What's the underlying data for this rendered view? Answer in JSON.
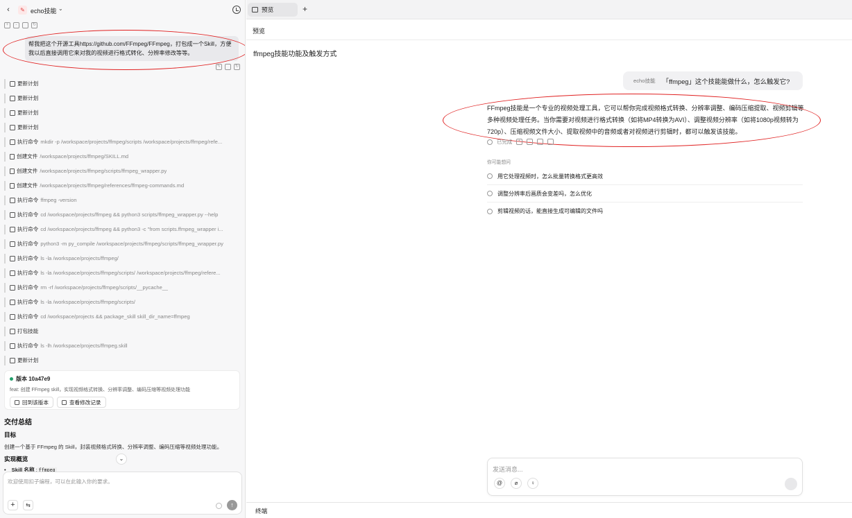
{
  "header": {
    "back_icon": "chevron-left-icon",
    "app_name": "echo技能",
    "history_icon": "history-icon"
  },
  "chat": {
    "user_message": "帮我把这个开源工具https://github.com/FFmpeg/FFmpeg，打包成一个Skill，方便我以后直接调用它来对我的视频进行格式转化、分辨率修改等等。",
    "steps": [
      {
        "icon": "terminal-icon",
        "label": "更新计划",
        "arg": ""
      },
      {
        "icon": "terminal-icon",
        "label": "更新计划",
        "arg": ""
      },
      {
        "icon": "terminal-icon",
        "label": "更新计划",
        "arg": ""
      },
      {
        "icon": "terminal-icon",
        "label": "更新计划",
        "arg": ""
      },
      {
        "icon": "terminal-icon",
        "label": "执行命令",
        "arg": "mkdir -p /workspace/projects/ffmpeg/scripts /workspace/projects/ffmpeg/refe..."
      },
      {
        "icon": "file-icon",
        "label": "创建文件",
        "arg": "/workspace/projects/ffmpeg/SKILL.md"
      },
      {
        "icon": "file-icon",
        "label": "创建文件",
        "arg": "/workspace/projects/ffmpeg/scripts/ffmpeg_wrapper.py"
      },
      {
        "icon": "file-icon",
        "label": "创建文件",
        "arg": "/workspace/projects/ffmpeg/references/ffmpeg-commands.md"
      },
      {
        "icon": "terminal-icon",
        "label": "执行命令",
        "arg": "ffmpeg -version"
      },
      {
        "icon": "terminal-icon",
        "label": "执行命令",
        "arg": "cd /workspace/projects/ffmpeg && python3 scripts/ffmpeg_wrapper.py --help"
      },
      {
        "icon": "terminal-icon",
        "label": "执行命令",
        "arg": "cd /workspace/projects/ffmpeg && python3 -c \"from scripts.ffmpeg_wrapper i..."
      },
      {
        "icon": "terminal-icon",
        "label": "执行命令",
        "arg": "python3 -m py_compile /workspace/projects/ffmpeg/scripts/ffmpeg_wrapper.py"
      },
      {
        "icon": "terminal-icon",
        "label": "执行命令",
        "arg": "ls -la /workspace/projects/ffmpeg/"
      },
      {
        "icon": "terminal-icon",
        "label": "执行命令",
        "arg": "ls -la /workspace/projects/ffmpeg/scripts/ /workspace/projects/ffmpeg/refere..."
      },
      {
        "icon": "terminal-icon",
        "label": "执行命令",
        "arg": "rm -rf /workspace/projects/ffmpeg/scripts/__pycache__"
      },
      {
        "icon": "terminal-icon",
        "label": "执行命令",
        "arg": "ls -la /workspace/projects/ffmpeg/scripts/"
      },
      {
        "icon": "terminal-icon",
        "label": "执行命令",
        "arg": "cd /workspace/projects && package_skill skill_dir_name=ffmpeg"
      },
      {
        "icon": "terminal-icon",
        "label": "打包技能",
        "arg": ""
      },
      {
        "icon": "terminal-icon",
        "label": "执行命令",
        "arg": "ls -lh /workspace/projects/ffmpeg.skill"
      },
      {
        "icon": "terminal-icon",
        "label": "更新计划",
        "arg": ""
      }
    ],
    "version": {
      "title": "版本 10a47e9",
      "desc": "feat: 创建 FFmpeg skill，实现视频格式转换、分辨率调整、编码压缩等视频处理功能",
      "rollback_label": "回到该版本",
      "history_label": "查看修改记录"
    },
    "summary": {
      "heading": "交付总结",
      "goal_heading": "目标",
      "goal_text": "创建一个基于 FFmpeg 的 Skill，封装视频格式转换、分辨率调整、编码压缩等视频处理功能。",
      "overview_heading": "实现概览",
      "bullet_label": "Skill 名称",
      "bullet_value": "ffmpeg"
    },
    "composer": {
      "placeholder": "欢迎使用扣子编程，可以在此输入你的要求。"
    }
  },
  "preview": {
    "tab_label": "预览",
    "header": "预览",
    "conversation_title": "ffmpeg技能功能及触发方式",
    "question_agent": "echo技能",
    "question": "「ffmpeg」这个技能能做什么，怎么触发它?",
    "answer": "FFmpeg技能是一个专业的视频处理工具，它可以帮你完成视频格式转换、分辨率调整、编码压缩提取、视频剪辑等多种视频处理任务。当你需要对视频进行格式转换（如将MP4转换为AVI）、调整视频分辨率（如将1080p视频转为720p）、压缩视频文件大小、提取视频中的音频或者对视频进行剪辑时，都可以触发该技能。",
    "status": "已完成",
    "suggest_label": "你可能想问",
    "suggestions": [
      "用它处理视频时，怎么批量转换格式更高效",
      "调整分辨率后画质会变差吗，怎么优化",
      "剪辑视频的话，能直接生成可编辑的文件吗"
    ],
    "input_placeholder": "发送消息...",
    "terminal_label": "终端"
  },
  "colors": {
    "annotation_red": "#e02020",
    "version_dot": "#22a06b"
  }
}
